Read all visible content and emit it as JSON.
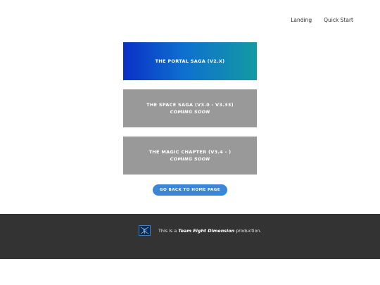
{
  "nav": {
    "landing": "Landing",
    "quick_start": "Quick Start"
  },
  "cards": [
    {
      "title": "THE PORTAL SAGA (V2.X)",
      "subtitle": ""
    },
    {
      "title": "THE SPACE SAGA (V3.0 - V3.33)",
      "subtitle": "COMING SOON"
    },
    {
      "title": "THE MAGIC CHAPTER (V3.4 - )",
      "subtitle": "COMING SOON"
    }
  ],
  "back_button": "GO BACK TO HOME PAGE",
  "footer": {
    "prefix": "This is a ",
    "brand": "Team Eight Dimension",
    "suffix": " production."
  },
  "colors": {
    "card_gradient_start": "#0a2fc6",
    "card_gradient_end": "#139aa3",
    "card_disabled": "#999999",
    "button": "#3b86d6",
    "footer_bg": "#333333"
  },
  "icons": {
    "footer_logo": "team-eight-dimension-logo"
  }
}
